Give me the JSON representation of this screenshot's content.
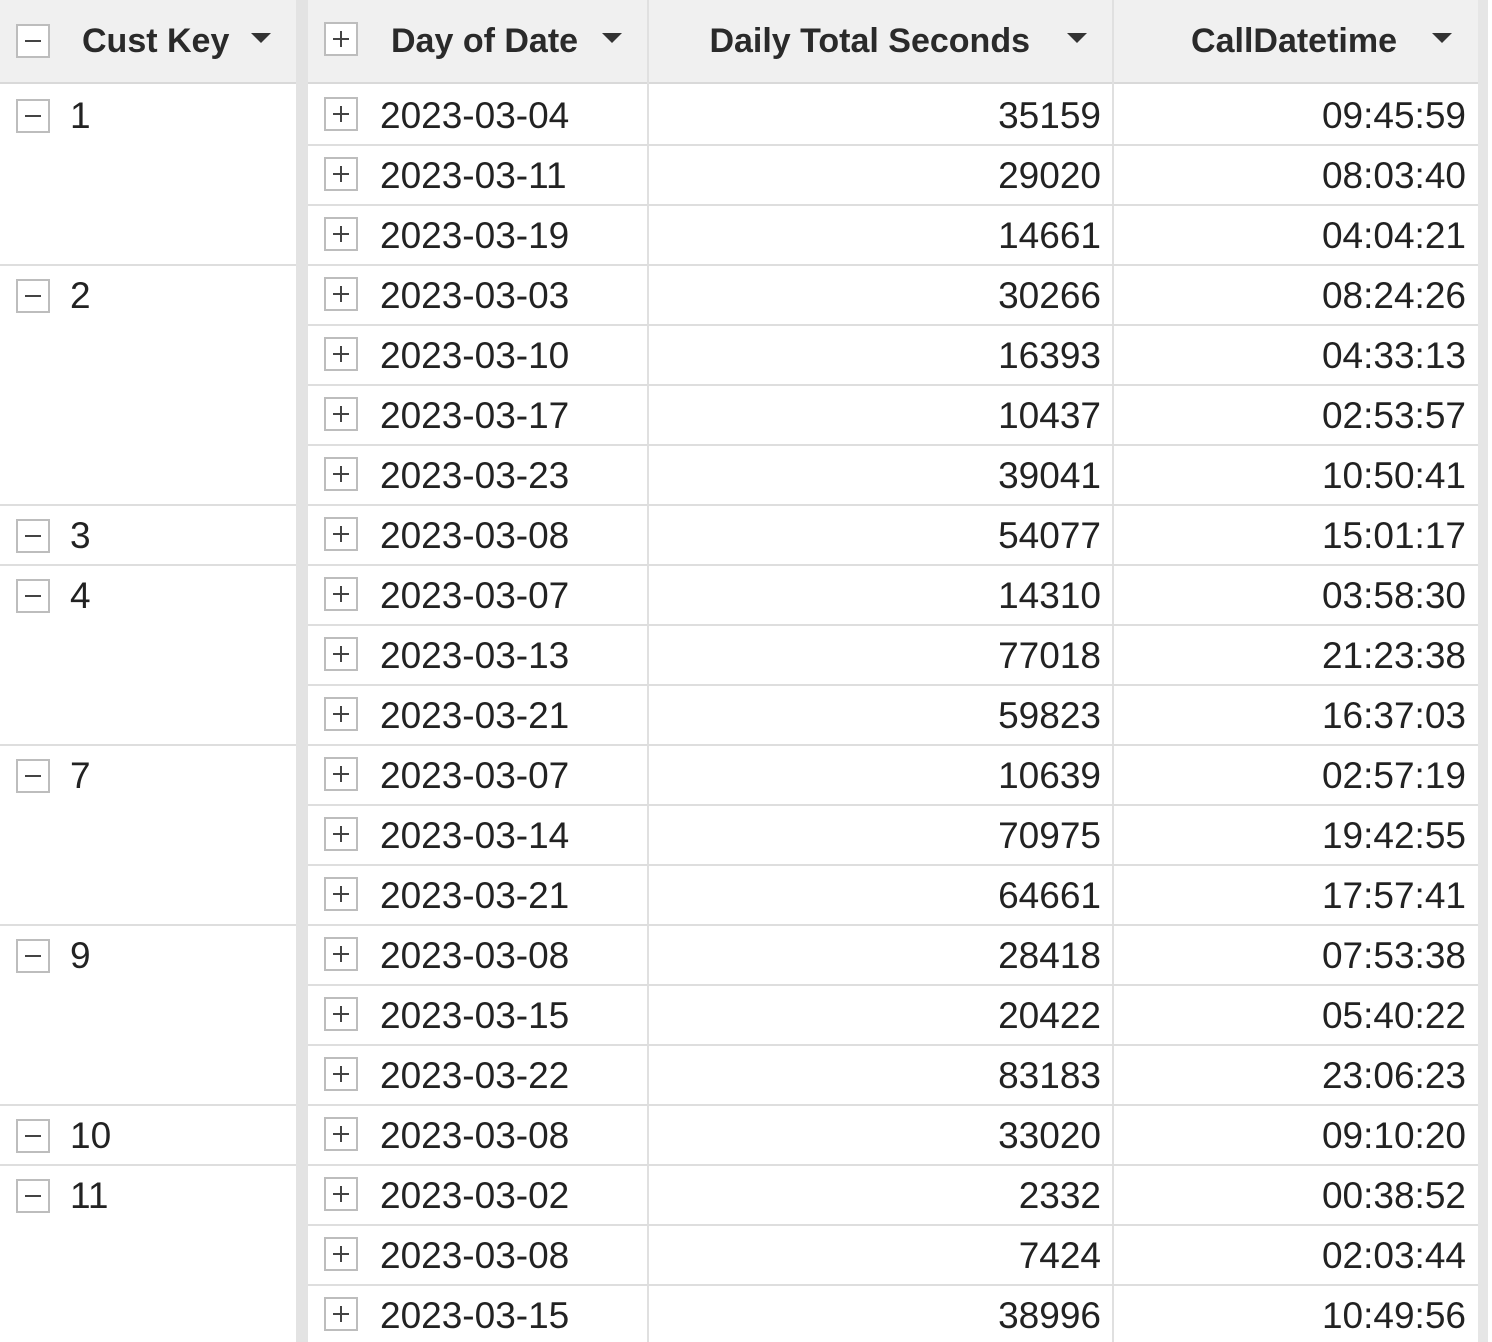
{
  "columns": {
    "cust_key": "Cust Key",
    "day_of_date": "Day of Date",
    "daily_total_seconds": "Daily Total Seconds",
    "call_datetime": "CallDatetime"
  },
  "groups": [
    {
      "cust_key": "1",
      "rows": [
        {
          "date": "2023-03-04",
          "seconds": "35159",
          "time": "09:45:59"
        },
        {
          "date": "2023-03-11",
          "seconds": "29020",
          "time": "08:03:40"
        },
        {
          "date": "2023-03-19",
          "seconds": "14661",
          "time": "04:04:21"
        }
      ]
    },
    {
      "cust_key": "2",
      "rows": [
        {
          "date": "2023-03-03",
          "seconds": "30266",
          "time": "08:24:26"
        },
        {
          "date": "2023-03-10",
          "seconds": "16393",
          "time": "04:33:13"
        },
        {
          "date": "2023-03-17",
          "seconds": "10437",
          "time": "02:53:57"
        },
        {
          "date": "2023-03-23",
          "seconds": "39041",
          "time": "10:50:41"
        }
      ]
    },
    {
      "cust_key": "3",
      "rows": [
        {
          "date": "2023-03-08",
          "seconds": "54077",
          "time": "15:01:17"
        }
      ]
    },
    {
      "cust_key": "4",
      "rows": [
        {
          "date": "2023-03-07",
          "seconds": "14310",
          "time": "03:58:30"
        },
        {
          "date": "2023-03-13",
          "seconds": "77018",
          "time": "21:23:38"
        },
        {
          "date": "2023-03-21",
          "seconds": "59823",
          "time": "16:37:03"
        }
      ]
    },
    {
      "cust_key": "7",
      "rows": [
        {
          "date": "2023-03-07",
          "seconds": "10639",
          "time": "02:57:19"
        },
        {
          "date": "2023-03-14",
          "seconds": "70975",
          "time": "19:42:55"
        },
        {
          "date": "2023-03-21",
          "seconds": "64661",
          "time": "17:57:41"
        }
      ]
    },
    {
      "cust_key": "9",
      "rows": [
        {
          "date": "2023-03-08",
          "seconds": "28418",
          "time": "07:53:38"
        },
        {
          "date": "2023-03-15",
          "seconds": "20422",
          "time": "05:40:22"
        },
        {
          "date": "2023-03-22",
          "seconds": "83183",
          "time": "23:06:23"
        }
      ]
    },
    {
      "cust_key": "10",
      "rows": [
        {
          "date": "2023-03-08",
          "seconds": "33020",
          "time": "09:10:20"
        }
      ]
    },
    {
      "cust_key": "11",
      "rows": [
        {
          "date": "2023-03-02",
          "seconds": "2332",
          "time": "00:38:52"
        },
        {
          "date": "2023-03-08",
          "seconds": "7424",
          "time": "02:03:44"
        },
        {
          "date": "2023-03-15",
          "seconds": "38996",
          "time": "10:49:56"
        }
      ]
    }
  ]
}
